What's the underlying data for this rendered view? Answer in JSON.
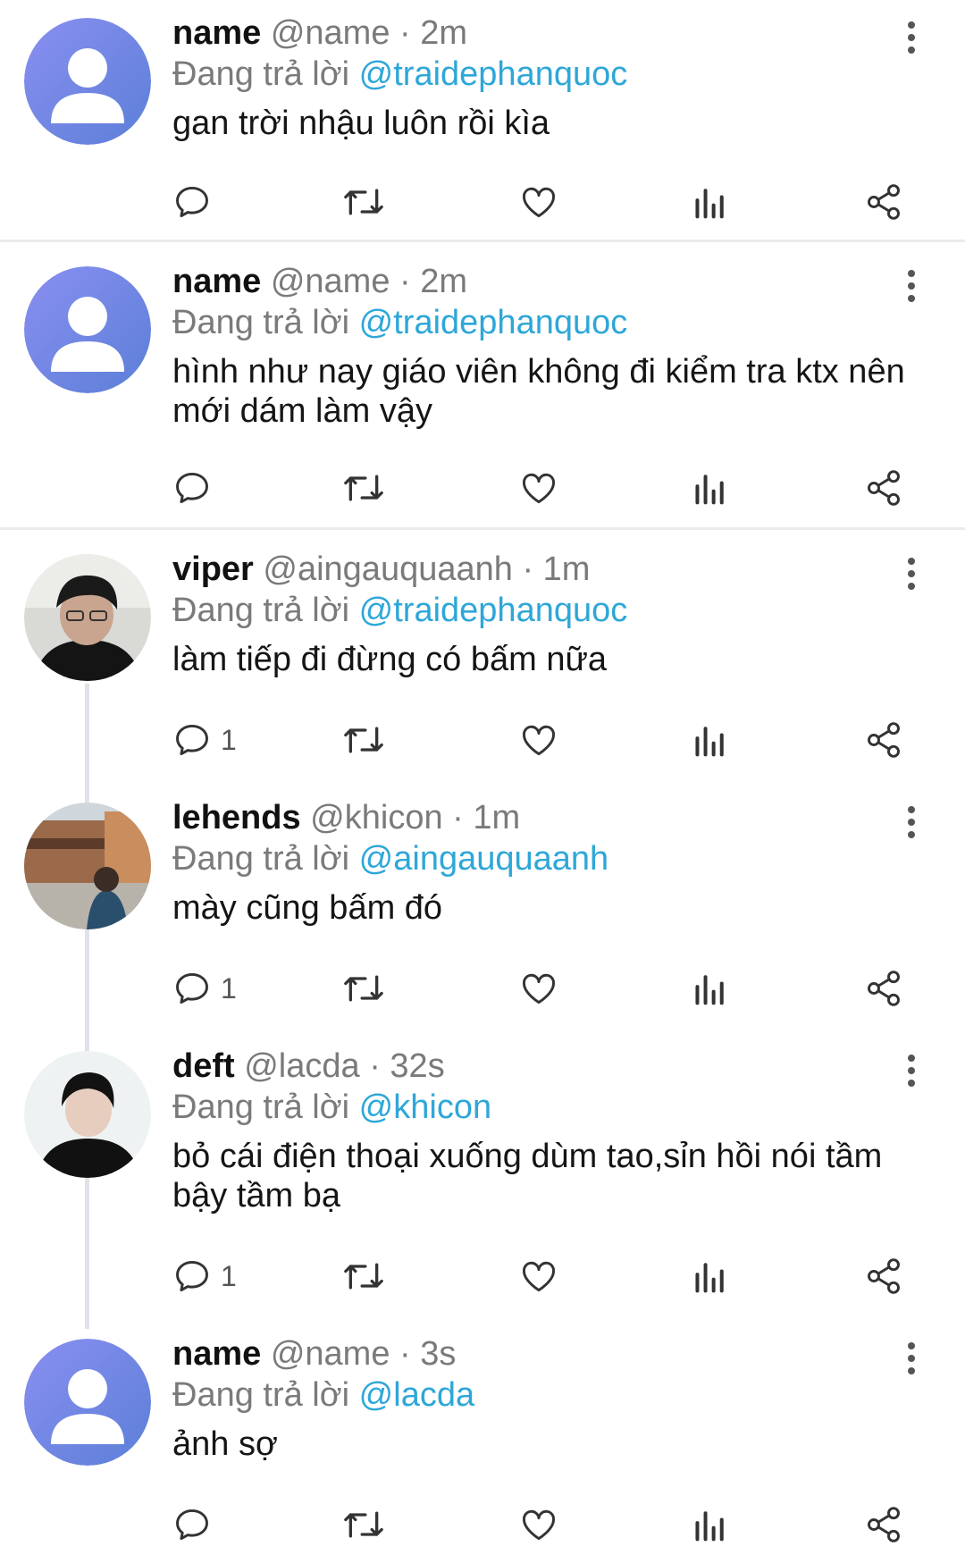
{
  "reply_prefix": "Đang trả lời",
  "colors": {
    "mention": "#2ea7d8",
    "divider": "#e9ecef",
    "icon": "#333333",
    "thread_line": "#dfe3e7"
  },
  "icons": [
    "reply-icon",
    "retweet-icon",
    "like-icon",
    "stats-icon",
    "share-icon",
    "more-vertical-icon"
  ],
  "tweets": [
    {
      "name": "name",
      "handle": "@name",
      "separator": "·",
      "time": "2m",
      "reply_to": "@traidephanquoc",
      "text": "gan trời nhậu luôn rồi kìa",
      "reply_count": "",
      "avatar": "default-avatar"
    },
    {
      "name": "name",
      "handle": "@name",
      "separator": "·",
      "time": "2m",
      "reply_to": "@traidephanquoc",
      "text": "hình như nay giáo viên không đi kiểm tra ktx nên mới dám làm vậy",
      "reply_count": "",
      "avatar": "default-avatar"
    },
    {
      "name": "viper",
      "handle": "@aingauquaanh",
      "separator": "·",
      "time": "1m",
      "reply_to": "@traidephanquoc",
      "text": "làm tiếp đi đừng có bấm nữa",
      "reply_count": "1",
      "avatar": "photo-avatar"
    },
    {
      "name": "lehends",
      "handle": "@khicon",
      "separator": "·",
      "time": "1m",
      "reply_to": "@aingauquaanh",
      "text": "mày cũng bấm đó",
      "reply_count": "1",
      "avatar": "photo-avatar"
    },
    {
      "name": "deft",
      "handle": "@lacda",
      "separator": "·",
      "time": "32s",
      "reply_to": "@khicon",
      "text": "bỏ cái điện thoại xuống dùm tao,sỉn hồi nói tầm bậy tầm bạ",
      "reply_count": "1",
      "avatar": "photo-avatar"
    },
    {
      "name": "name",
      "handle": "@name",
      "separator": "·",
      "time": "3s",
      "reply_to": "@lacda",
      "text": "ảnh sợ",
      "reply_count": "",
      "avatar": "default-avatar"
    }
  ]
}
